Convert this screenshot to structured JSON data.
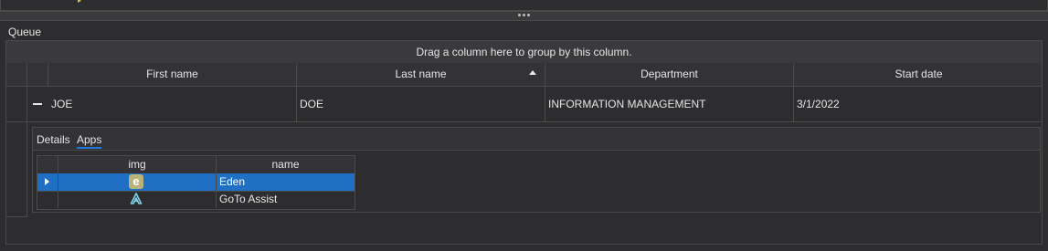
{
  "queue": {
    "title": "Queue"
  },
  "grid": {
    "group_hint": "Drag a column here to group by this column.",
    "columns": [
      "First name",
      "Last name",
      "Department",
      "Start date"
    ],
    "sort": {
      "column": "Last name",
      "direction": "ascending"
    },
    "rows": [
      {
        "first_name": "JOE",
        "last_name": "DOE",
        "department": "INFORMATION MANAGEMENT",
        "start_date": "3/1/2022",
        "expanded": true
      }
    ]
  },
  "detail": {
    "tabs": [
      {
        "label": "Details",
        "active": false
      },
      {
        "label": "Apps",
        "active": true
      }
    ],
    "apps_grid": {
      "columns": [
        "img",
        "name"
      ],
      "rows": [
        {
          "icon": "eden-app-icon",
          "icon_glyph": "e",
          "name": "Eden",
          "selected": true
        },
        {
          "icon": "goto-assist-icon",
          "name": "GoTo Assist",
          "selected": false
        }
      ]
    }
  },
  "colors": {
    "accent": "#1f79d6",
    "selection": "#1f6fc4",
    "background": "#2d2d30",
    "border": "#4a4a4a",
    "eden_icon": "#b9b37a",
    "goto_icon": "#7fd1e6"
  }
}
